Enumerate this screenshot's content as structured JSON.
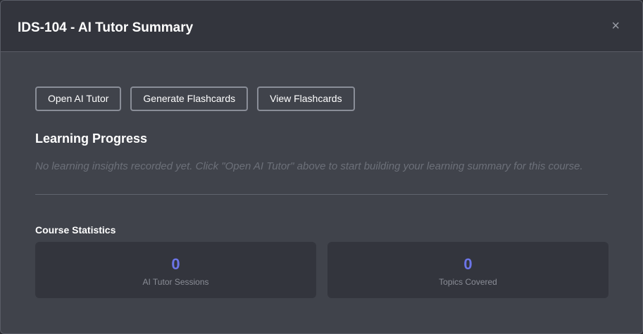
{
  "modal": {
    "title": "IDS-104 - AI Tutor Summary",
    "close_glyph": "×"
  },
  "actions": {
    "open_ai_tutor": "Open AI Tutor",
    "generate_flashcards": "Generate Flashcards",
    "view_flashcards": "View Flashcards"
  },
  "learning_progress": {
    "heading": "Learning Progress",
    "empty_message": "No learning insights recorded yet. Click \"Open AI Tutor\" above to start building your learning summary for this course."
  },
  "course_statistics": {
    "heading": "Course Statistics",
    "stats": [
      {
        "value": "0",
        "label": "AI Tutor Sessions"
      },
      {
        "value": "0",
        "label": "Topics Covered"
      }
    ]
  },
  "colors": {
    "accent": "#6c75e8",
    "panel_bg": "#40434b",
    "header_bg": "#33353d"
  }
}
